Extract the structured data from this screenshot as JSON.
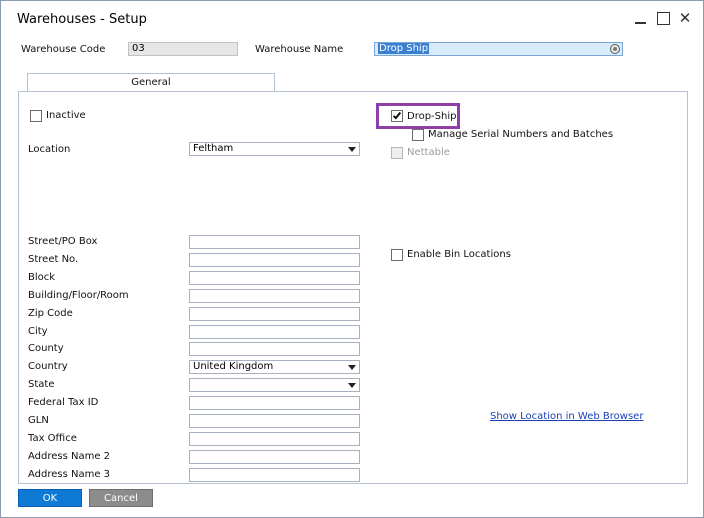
{
  "window": {
    "title": "Warehouses - Setup"
  },
  "header": {
    "code_label": "Warehouse Code",
    "code_value": "03",
    "name_label": "Warehouse Name",
    "name_value": "Drop Ship"
  },
  "tabs": [
    {
      "label": "General",
      "active": true
    }
  ],
  "general": {
    "inactive_label": "Inactive",
    "inactive_checked": false,
    "location_label": "Location",
    "location_value": "Feltham",
    "drop_ship_label": "Drop-Ship",
    "drop_ship_checked": true,
    "manage_serial_label": "Manage Serial Numbers and Batches",
    "manage_serial_checked": false,
    "nettable_label": "Nettable",
    "nettable_checked": false,
    "enable_bin_label": "Enable Bin Locations",
    "enable_bin_checked": false,
    "address_fields": [
      {
        "label": "Street/PO Box",
        "value": "",
        "type": "text"
      },
      {
        "label": "Street No.",
        "value": "",
        "type": "text"
      },
      {
        "label": "Block",
        "value": "",
        "type": "text"
      },
      {
        "label": "Building/Floor/Room",
        "value": "",
        "type": "text"
      },
      {
        "label": "Zip Code",
        "value": "",
        "type": "text"
      },
      {
        "label": "City",
        "value": "",
        "type": "text"
      },
      {
        "label": "County",
        "value": "",
        "type": "text"
      },
      {
        "label": "Country",
        "value": "United Kingdom",
        "type": "select"
      },
      {
        "label": "State",
        "value": "",
        "type": "select"
      },
      {
        "label": "Federal Tax ID",
        "value": "",
        "type": "text"
      },
      {
        "label": "GLN",
        "value": "",
        "type": "text"
      },
      {
        "label": "Tax Office",
        "value": "",
        "type": "text"
      },
      {
        "label": "Address Name 2",
        "value": "",
        "type": "text"
      },
      {
        "label": "Address Name 3",
        "value": "",
        "type": "text"
      }
    ],
    "show_location_link": "Show Location in Web Browser"
  },
  "footer": {
    "ok_label": "OK",
    "cancel_label": "Cancel"
  },
  "colors": {
    "accent": "#0f7ad6",
    "highlight": "#8e3fa8",
    "link": "#1a3fb5"
  }
}
